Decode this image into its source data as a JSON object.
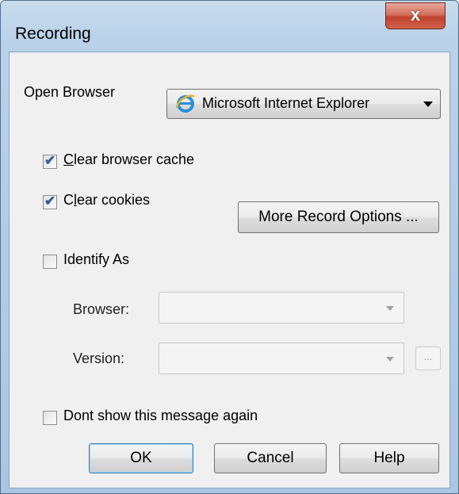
{
  "window": {
    "title": "Recording",
    "close_symbol": "x"
  },
  "open_browser": {
    "label": "Open Browser",
    "selected": "Microsoft Internet Explorer",
    "icon": "internet-explorer-icon"
  },
  "options": {
    "clear_cache": {
      "label_prefix": "",
      "label_accel": "C",
      "label_rest": "lear browser cache",
      "checked": true
    },
    "clear_cookies": {
      "label_prefix": "C",
      "label_accel": "l",
      "label_rest": "ear cookies",
      "checked": true
    },
    "more_options_label": "More Record Options ...",
    "identify_as": {
      "label": "Identify As",
      "checked": false
    }
  },
  "identify": {
    "browser_label": "Browser:",
    "browser_value": "",
    "version_label": "Version:",
    "version_value": "",
    "ellipsis_label": "..."
  },
  "dont_show": {
    "label": "Dont show this message again",
    "checked": false
  },
  "buttons": {
    "ok": "OK",
    "cancel": "Cancel",
    "help": "Help"
  },
  "colors": {
    "accent": "#3a5a9b",
    "close": "#c0422e",
    "title_bar": "#b9d1e9"
  }
}
